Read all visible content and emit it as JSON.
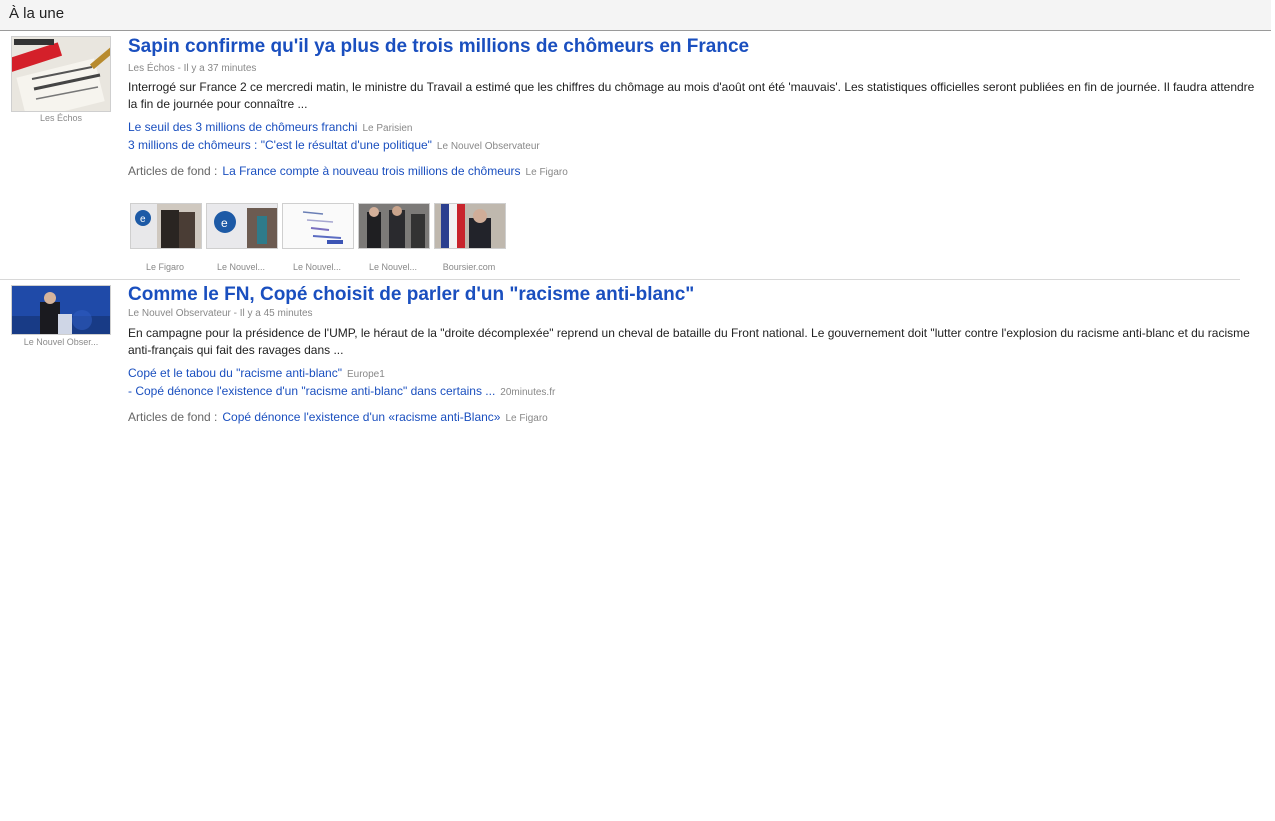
{
  "header": {
    "title": "À la une"
  },
  "stories": [
    {
      "thumb_source": "Les Échos",
      "headline": "Sapin confirme qu'il ya plus de trois millions de chômeurs en France",
      "meta": "Les Échos - Il y a 37 minutes",
      "snippet": "Interrogé sur France 2 ce mercredi matin, le ministre du Travail a estimé que les chiffres du chômage au mois d'août ont été 'mauvais'. Les statistiques officielles seront publiées en fin de journée. Il faudra attendre la fin de journée pour connaître ...",
      "related": [
        {
          "title": "Le seuil des 3 millions de chômeurs franchi",
          "source": "Le Parisien"
        },
        {
          "title": "3 millions de chômeurs : \"C'est le résultat d'une politique\"",
          "source": "Le Nouvel Observateur"
        }
      ],
      "fond": {
        "label": "Articles de fond :",
        "title": "La France compte à nouveau trois millions de chômeurs",
        "source": "Le Figaro"
      },
      "images": [
        {
          "caption": "Le Figaro"
        },
        {
          "caption": "Le Nouvel..."
        },
        {
          "caption": "Le Nouvel..."
        },
        {
          "caption": "Le Nouvel..."
        },
        {
          "caption": "Boursier.com"
        }
      ]
    },
    {
      "thumb_source": "Le Nouvel Obser...",
      "headline": "Comme le FN, Copé choisit de parler d'un \"racisme anti-blanc\"",
      "meta": "Le Nouvel Observateur - Il y a 45 minutes",
      "snippet": "En campagne pour la présidence de l'UMP, le héraut de la \"droite décomplexée\" reprend un cheval de bataille du Front national. Le gouvernement doit \"lutter contre l'explosion du racisme anti-blanc et du racisme anti-français qui fait des ravages dans ...",
      "related": [
        {
          "title": "Copé et le tabou du \"racisme anti-blanc\"",
          "source": "Europe1"
        },
        {
          "title": "- Copé dénonce l'existence d'un \"racisme anti-blanc\" dans certains ...",
          "source": "20minutes.fr"
        }
      ],
      "fond": {
        "label": "Articles de fond :",
        "title": "Copé dénonce l'existence d'un «racisme anti-Blanc»",
        "source": "Le Figaro"
      }
    }
  ]
}
